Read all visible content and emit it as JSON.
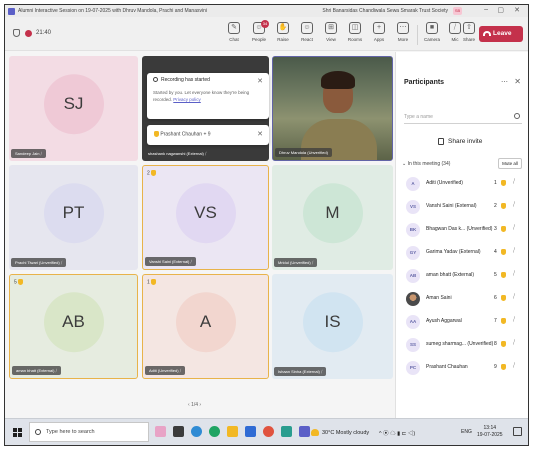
{
  "window": {
    "title": "Alumni Interactive Session on 19-07-2025 with Dhruv Mandola, Prachi and Manasvini",
    "organization": "Shri Banarsidas Chandiwala Sewa Smarak Trust Society",
    "org_badge": "SB",
    "minimize": "–",
    "maximize": "▢",
    "close": "✕"
  },
  "toolbar": {
    "timer": "21:40",
    "buttons": [
      {
        "label": "Chat",
        "icon": "chat-icon",
        "glyph": "✎"
      },
      {
        "label": "People",
        "icon": "people-icon",
        "glyph": "☺",
        "badge": "34"
      },
      {
        "label": "Raise",
        "icon": "hand-icon",
        "glyph": "✋"
      },
      {
        "label": "React",
        "icon": "smile-icon",
        "glyph": "☺"
      },
      {
        "label": "View",
        "icon": "grid-icon",
        "glyph": "⊞"
      },
      {
        "label": "Rooms",
        "icon": "rooms-icon",
        "glyph": "◫"
      },
      {
        "label": "Apps",
        "icon": "apps-icon",
        "glyph": "+"
      },
      {
        "label": "More",
        "icon": "more-icon",
        "glyph": "⋯"
      },
      {
        "label": "Camera",
        "icon": "camera-icon",
        "glyph": "■"
      },
      {
        "label": "Mic",
        "icon": "mic-icon",
        "glyph": "⧸"
      },
      {
        "label": "Share",
        "icon": "share-icon",
        "glyph": "⇧"
      }
    ],
    "leave_label": "Leave"
  },
  "recording": {
    "title": "Recording has started",
    "body": "Started by you. Let everyone know they're being recorded.",
    "link": "Privacy policy",
    "toast": "Prashant Chauhan + 9"
  },
  "tiles": [
    {
      "initials": "SJ",
      "name": "Sandeep Jain",
      "bg": "#f3dce4",
      "avatar": "#efc9d6"
    },
    {
      "initials": "",
      "name": "shashank nagwanshi (External)",
      "bg": "#3a3a3a",
      "avatar": "#3a3a3a"
    },
    {
      "initials": "",
      "name": "Dhruv Mandola (Unverified)",
      "bg": "#4b5a4a",
      "avatar": "#4b5a4a"
    },
    {
      "initials": "PT",
      "name": "Prachi Tiwari (Unverified)",
      "bg": "#e6e6ef",
      "avatar": "#dcdcef"
    },
    {
      "initials": "VS",
      "name": "Vanshi Saini (External)",
      "bg": "#ebe6f3",
      "avatar": "#e1d8f2",
      "order": "2"
    },
    {
      "initials": "M",
      "name": "Mridul (Unverified)",
      "bg": "#e0ece4",
      "avatar": "#cde6d6"
    },
    {
      "initials": "AB",
      "name": "aman bhatt (External)",
      "bg": "#e6ece0",
      "avatar": "#d9e6c8",
      "order": "5"
    },
    {
      "initials": "A",
      "name": "Aditi (Unverified)",
      "bg": "#f4e6e2",
      "avatar": "#f2d6cf",
      "order": "1"
    },
    {
      "initials": "IS",
      "name": "Ishaan Sinha (External)",
      "bg": "#e2ebf2",
      "avatar": "#d1e4f1"
    }
  ],
  "pager": "1/4",
  "participants": {
    "title": "Participants",
    "menu": "⋯",
    "close": "✕",
    "search_placeholder": "Type a name",
    "share_invite": "Share invite",
    "section": "In this meeting (34)",
    "mute_all": "Mute all",
    "people": [
      {
        "initials": "A",
        "name": "Aditi (Unverified)",
        "order": "1"
      },
      {
        "initials": "VS",
        "name": "Vanshi Saini (External)",
        "order": "2"
      },
      {
        "initials": "BK",
        "name": "Bhagwan Das k... (Unverified)",
        "order": "3"
      },
      {
        "initials": "GY",
        "name": "Garima Yadav (External)",
        "order": "4"
      },
      {
        "initials": "AB",
        "name": "aman bhatt (External)",
        "order": "5"
      },
      {
        "initials": "",
        "name": "Aman Saini",
        "order": "6",
        "photo": true
      },
      {
        "initials": "AA",
        "name": "Ayush Aggarwal",
        "order": "7"
      },
      {
        "initials": "SS",
        "name": "sumeg sharmag... (Unverified)",
        "order": "8"
      },
      {
        "initials": "PC",
        "name": "Prashant Chauhan",
        "order": "9"
      }
    ]
  },
  "taskbar": {
    "search_placeholder": "Type here to search",
    "weather": "30°C  Mostly cloudy",
    "lang": "ENG",
    "time": "13:14",
    "date": "19-07-2025"
  },
  "colors": {
    "accent": "#5b5fc7",
    "leave": "#c4314b",
    "hand": "#f2b824",
    "active_border": "#e8b34a"
  }
}
